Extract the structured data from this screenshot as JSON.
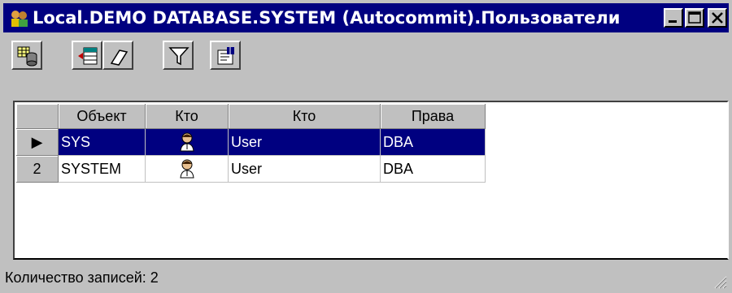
{
  "window": {
    "title": "Local.DEMO DATABASE.SYSTEM (Autocommit).Пользователи"
  },
  "toolbar": {
    "buttons": [
      {
        "icon": "table-properties-icon"
      },
      {
        "icon": "insert-record-icon"
      },
      {
        "icon": "eraser-icon"
      },
      {
        "icon": "filter-icon"
      },
      {
        "icon": "properties-icon"
      }
    ]
  },
  "grid": {
    "columns": [
      "Объект",
      "Кто",
      "Кто",
      "Права"
    ],
    "rows": [
      {
        "indicator": "▶",
        "object": "SYS",
        "who_icon": "user-icon",
        "who": "User",
        "rights": "DBA",
        "selected": true
      },
      {
        "indicator": "2",
        "object": "SYSTEM",
        "who_icon": "user-icon",
        "who": "User",
        "rights": "DBA",
        "selected": false
      }
    ]
  },
  "status": {
    "text": "Количество записей: 2"
  }
}
